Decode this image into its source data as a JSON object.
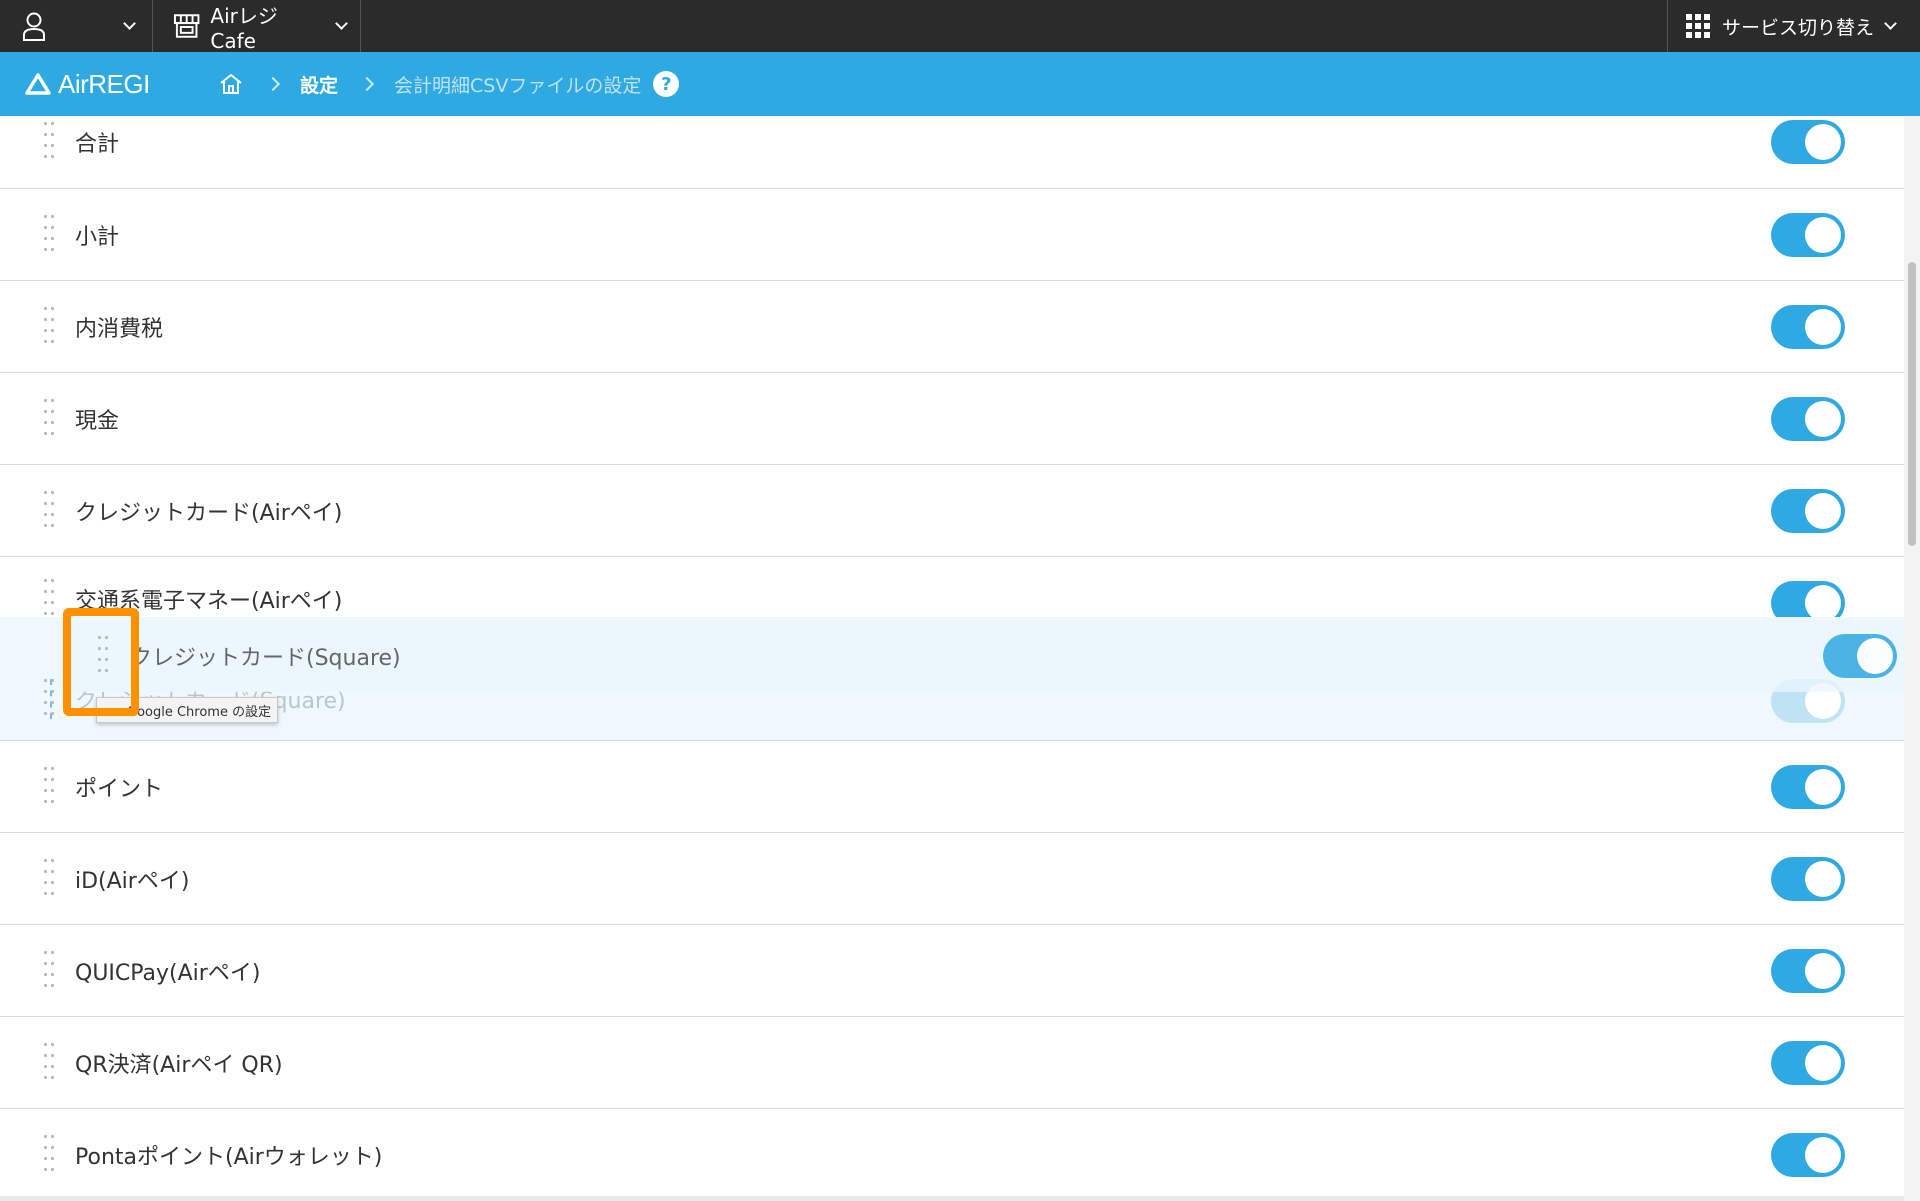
{
  "topbar": {
    "store_label": "Airレジ Cafe",
    "service_switch_label": "サービス切り替え"
  },
  "header": {
    "logo_text": "AirREGI",
    "breadcrumb": {
      "settings": "設定",
      "current_page": "会計明細CSVファイルの設定"
    }
  },
  "items": [
    {
      "label": "合計",
      "enabled": true
    },
    {
      "label": "小計",
      "enabled": true
    },
    {
      "label": "内消費税",
      "enabled": true
    },
    {
      "label": "現金",
      "enabled": true
    },
    {
      "label": "クレジットカード(Airペイ)",
      "enabled": true
    },
    {
      "label": "交通系電子マネー(Airペイ)",
      "enabled": true
    },
    {
      "label": "クレジットカード(Square)",
      "enabled": true
    },
    {
      "label": "ポイント",
      "enabled": true
    },
    {
      "label": "iD(Airペイ)",
      "enabled": true
    },
    {
      "label": "QUICPay(Airペイ)",
      "enabled": true
    },
    {
      "label": "QR決済(Airペイ QR)",
      "enabled": true
    },
    {
      "label": "Pontaポイント(Airウォレット)",
      "enabled": true
    }
  ],
  "drag_ghost": {
    "label": "クレジットカード(Square)"
  },
  "tooltip": {
    "text": "Google Chrome の設定"
  },
  "colors": {
    "brand_blue": "#2fa9e1",
    "topbar": "#2b2b2b",
    "highlight": "#ff9100"
  }
}
